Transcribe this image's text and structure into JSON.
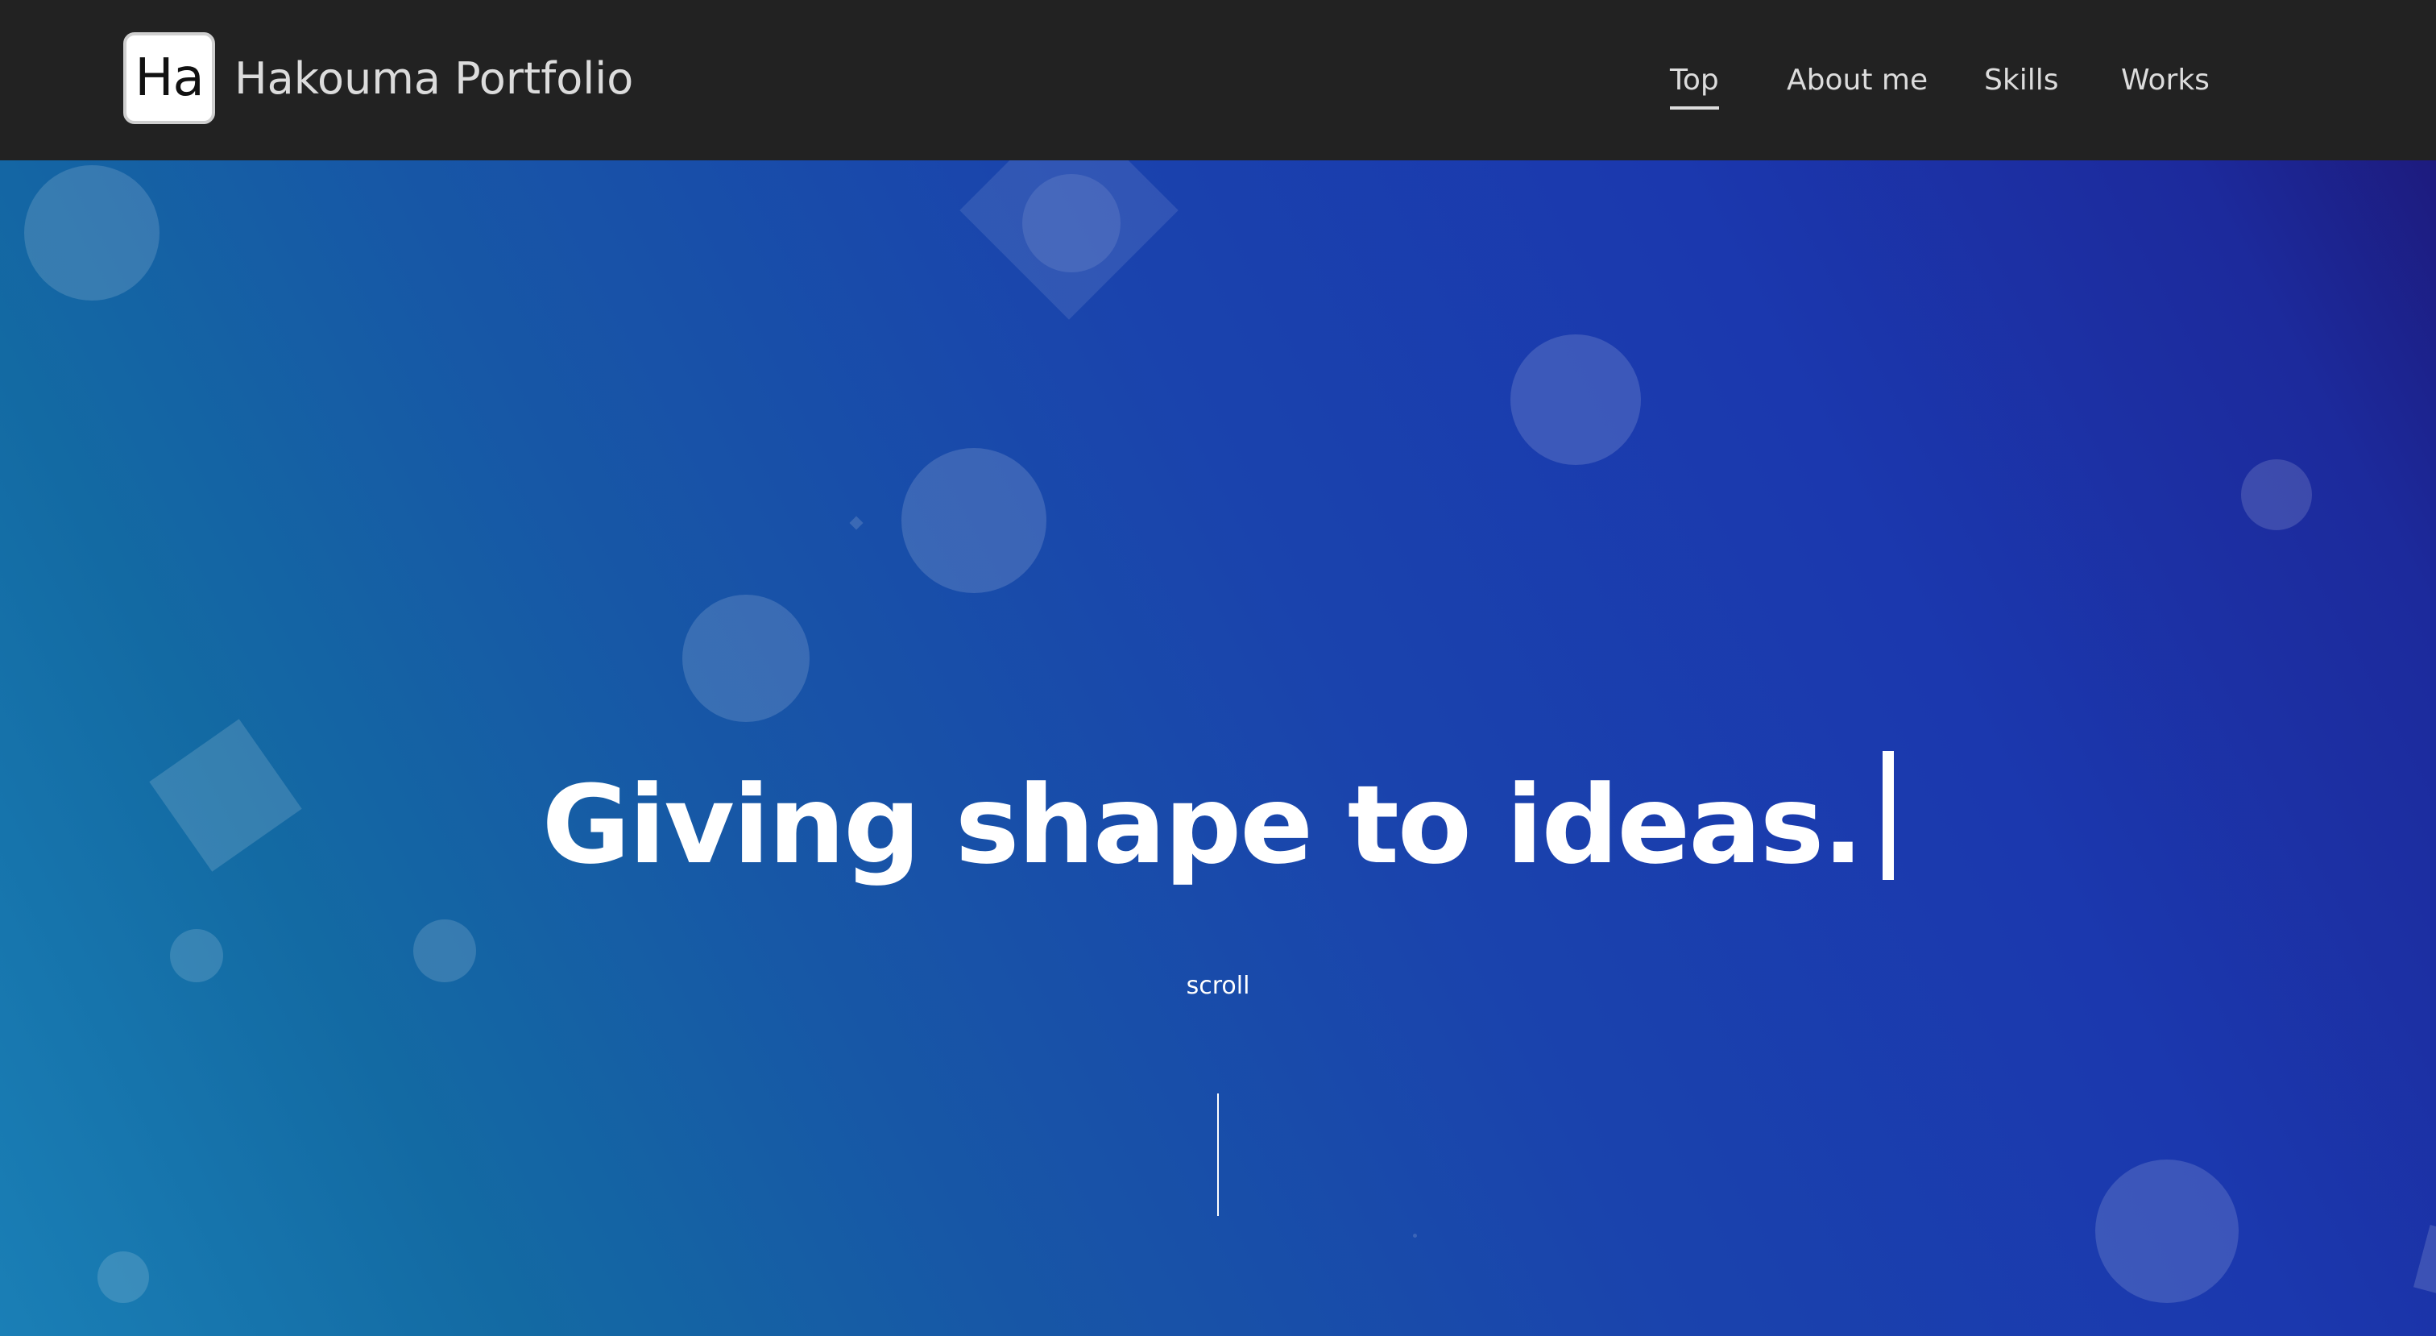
{
  "header": {
    "logo_text": "Ha",
    "site_title": "Hakouma Portfolio",
    "nav": [
      {
        "label": "Top",
        "active": true
      },
      {
        "label": "About me",
        "active": false
      },
      {
        "label": "Skills",
        "active": false
      },
      {
        "label": "Works",
        "active": false
      }
    ]
  },
  "hero": {
    "headline": "Giving shape to ideas.",
    "scroll_label": "scroll"
  },
  "colors": {
    "header_bg": "#222222",
    "gradient_start": "#1a7fb6",
    "gradient_end": "#1d1b7e",
    "text": "#ffffff"
  }
}
